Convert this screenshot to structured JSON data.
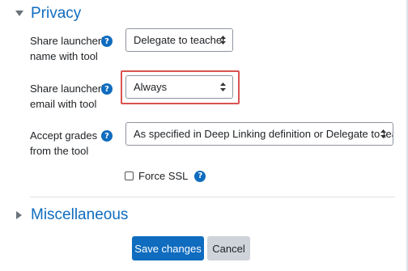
{
  "privacy": {
    "title": "Privacy",
    "name": {
      "label_line1": "Share launcher's",
      "label_line2": "name with tool",
      "value": "Delegate to teacher"
    },
    "email": {
      "label_line1": "Share launcher's",
      "label_line2": "email with tool",
      "value": "Always"
    },
    "grades": {
      "label_line1": "Accept grades",
      "label_line2": "from the tool",
      "value": "As specified in Deep Linking definition or Delegate to teach"
    },
    "force_ssl": {
      "label": "Force SSL",
      "checked": false
    }
  },
  "misc": {
    "title": "Miscellaneous"
  },
  "actions": {
    "save": "Save changes",
    "cancel": "Cancel"
  },
  "colors": {
    "accent": "#0f6cbf",
    "highlight": "#d9534f",
    "secondary_btn": "#ced4da"
  },
  "icons": {
    "help": "?"
  }
}
